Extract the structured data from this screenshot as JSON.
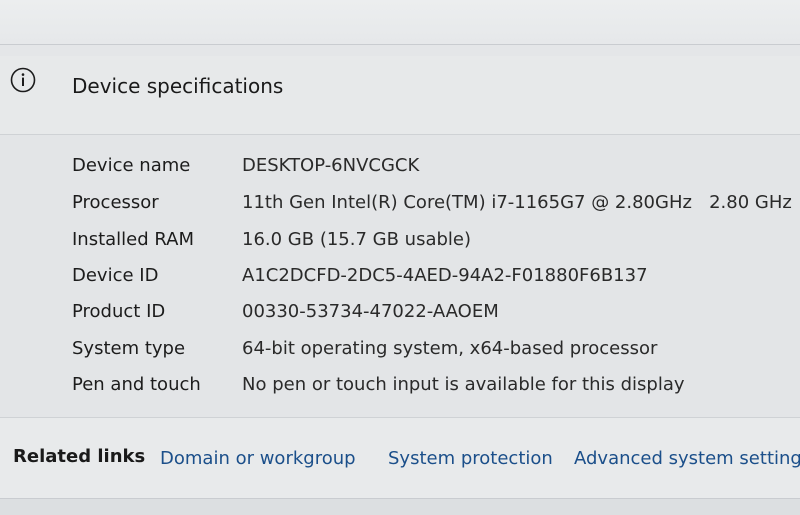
{
  "header": {
    "title": "Device specifications",
    "icon": "info-icon"
  },
  "specs": [
    {
      "label": "Device name",
      "value": "DESKTOP-6NVCGCK"
    },
    {
      "label": "Processor",
      "value": "11th Gen Intel(R) Core(TM) i7-1165G7 @ 2.80GHz   2.80 GHz"
    },
    {
      "label": "Installed RAM",
      "value": "16.0 GB (15.7 GB usable)"
    },
    {
      "label": "Device ID",
      "value": "A1C2DCFD-2DC5-4AED-94A2-F01880F6B137"
    },
    {
      "label": "Product ID",
      "value": "00330-53734-47022-AAOEM"
    },
    {
      "label": "System type",
      "value": "64-bit operating system, x64-based processor"
    },
    {
      "label": "Pen and touch",
      "value": "No pen or touch input is available for this display"
    }
  ],
  "related": {
    "label": "Related links",
    "links": [
      {
        "label": "Domain or workgroup"
      },
      {
        "label": "System protection"
      },
      {
        "label": "Advanced system settings"
      }
    ]
  },
  "colors": {
    "link": "#1b4f8a",
    "background": "#e4e6e8"
  }
}
